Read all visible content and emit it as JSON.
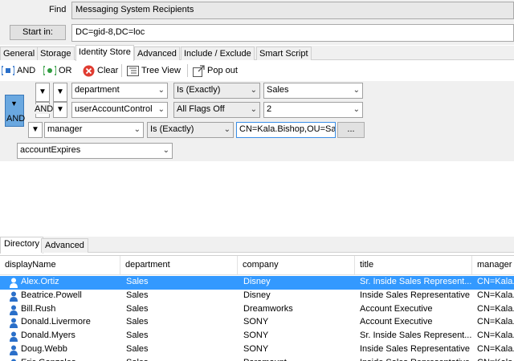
{
  "find": {
    "label": "Find",
    "value": "Messaging System Recipients"
  },
  "start_in": {
    "button_label": "Start in:",
    "value": "DC=gid-8,DC=loc"
  },
  "tabs": [
    "General",
    "Storage",
    "Identity Store",
    "Advanced",
    "Include / Exclude",
    "Smart Script"
  ],
  "active_tab": "Identity Store",
  "toolbar": {
    "and_label": "AND",
    "or_label": "OR",
    "clear_label": "Clear",
    "tree_view_label": "Tree View",
    "pop_out_label": "Pop out"
  },
  "criteria": {
    "group_operator": "AND",
    "rows": [
      {
        "operator": "",
        "attribute": "department",
        "condition": "Is (Exactly)",
        "value": "Sales"
      },
      {
        "operator": "AND",
        "attribute": "userAccountControl",
        "condition": "All Flags Off",
        "value": "2"
      },
      {
        "operator": "",
        "attribute": "manager",
        "condition": "Is (Exactly)",
        "value": "CN=Kala.Bishop,OU=Sale",
        "browse": "..."
      }
    ],
    "next_attribute": "accountExpires"
  },
  "panel_tabs": [
    "Directory",
    "Advanced"
  ],
  "active_panel_tab": "Directory",
  "grid": {
    "columns": [
      "displayName",
      "department",
      "company",
      "title",
      "manager"
    ],
    "rows": [
      [
        "Alex.Ortiz",
        "Sales",
        "Disney",
        "Sr. Inside Sales Represent...",
        "CN=Kala.I"
      ],
      [
        "Beatrice.Powell",
        "Sales",
        "Disney",
        "Inside Sales Representative",
        "CN=Kala.I"
      ],
      [
        "Bill.Rush",
        "Sales",
        "Dreamworks",
        "Account Executive",
        "CN=Kala.I"
      ],
      [
        "Donald.Livermore",
        "Sales",
        "SONY",
        "Account Executive",
        "CN=Kala.I"
      ],
      [
        "Donald.Myers",
        "Sales",
        "SONY",
        "Sr. Inside Sales Represent...",
        "CN=Kala.I"
      ],
      [
        "Doug.Webb",
        "Sales",
        "SONY",
        "Inside Sales Representative",
        "CN=Kala.I"
      ],
      [
        "Eric.Gonzales",
        "Sales",
        "Paramount",
        "Inside Sales Representative",
        "CN=Kala.I"
      ]
    ],
    "selected_row": 0
  },
  "colors": {
    "selection": "#3399ff",
    "and_block": "#6aa8e0",
    "clear_icon": "#e03c31",
    "user_icon": "#2a6fc9"
  }
}
